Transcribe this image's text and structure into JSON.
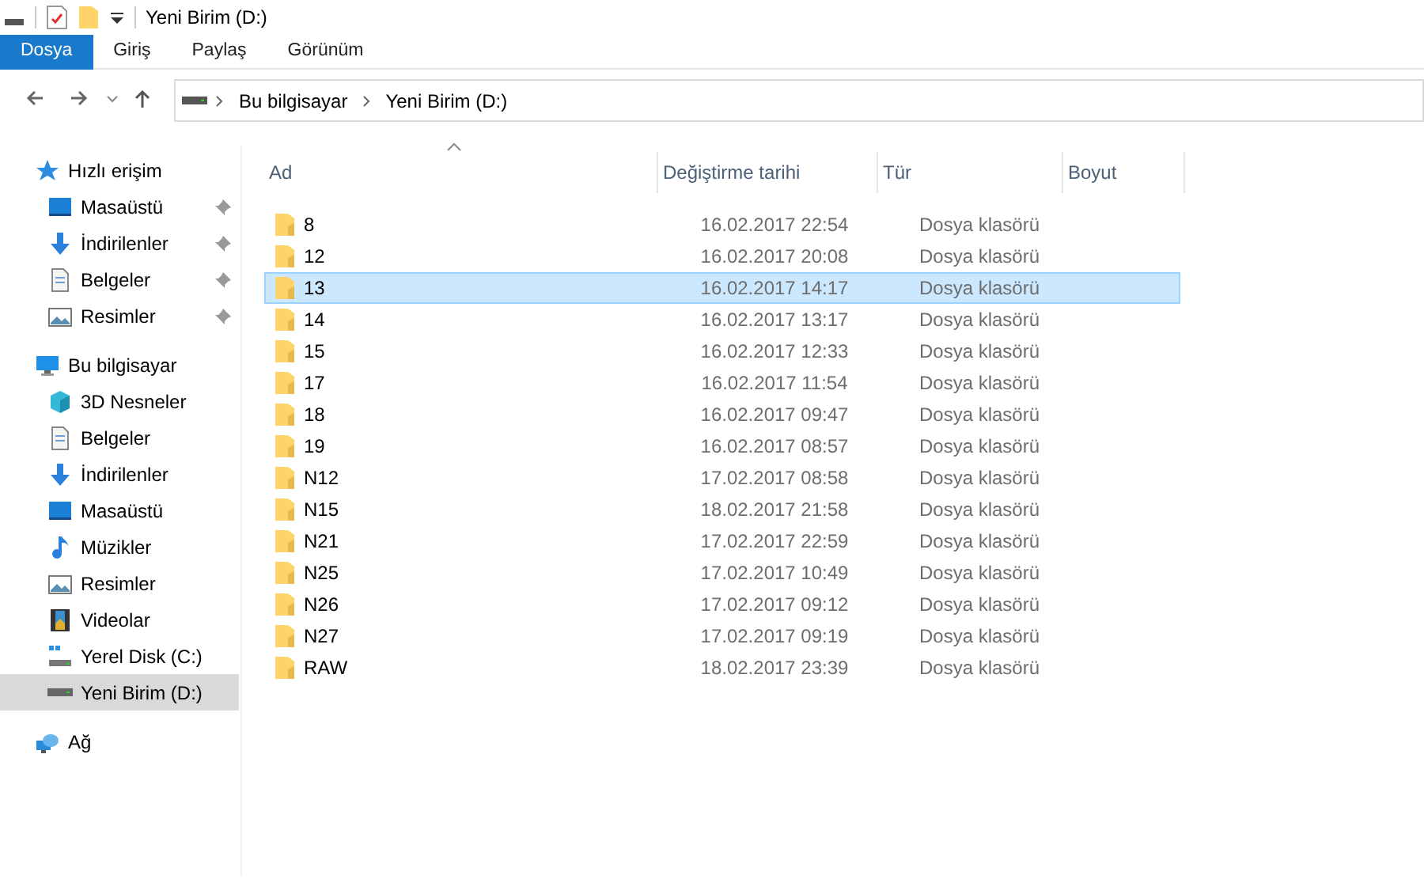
{
  "window": {
    "title": "Yeni Birim (D:)"
  },
  "ribbon_tabs": [
    {
      "label": "Dosya",
      "selected": true
    },
    {
      "label": "Giriş",
      "selected": false
    },
    {
      "label": "Paylaş",
      "selected": false
    },
    {
      "label": "Görünüm",
      "selected": false
    }
  ],
  "breadcrumb": [
    "Bu bilgisayar",
    "Yeni Birim (D:)"
  ],
  "sidebar": {
    "items": [
      {
        "label": "Hızlı erişim",
        "kind": "star",
        "selected": false,
        "children": [
          {
            "label": "Masaüstü",
            "kind": "desktop",
            "pinned": true,
            "selected": false
          },
          {
            "label": "İndirilenler",
            "kind": "download",
            "pinned": true,
            "selected": false
          },
          {
            "label": "Belgeler",
            "kind": "document",
            "pinned": true,
            "selected": false
          },
          {
            "label": "Resimler",
            "kind": "pictures",
            "pinned": true,
            "selected": false
          }
        ]
      },
      {
        "label": "Bu bilgisayar",
        "kind": "computer",
        "selected": false,
        "children": [
          {
            "label": "3D Nesneler",
            "kind": "cube",
            "pinned": false,
            "selected": false
          },
          {
            "label": "Belgeler",
            "kind": "document",
            "pinned": false,
            "selected": false
          },
          {
            "label": "İndirilenler",
            "kind": "download",
            "pinned": false,
            "selected": false
          },
          {
            "label": "Masaüstü",
            "kind": "desktop",
            "pinned": false,
            "selected": false
          },
          {
            "label": "Müzikler",
            "kind": "music",
            "pinned": false,
            "selected": false
          },
          {
            "label": "Resimler",
            "kind": "pictures",
            "pinned": false,
            "selected": false
          },
          {
            "label": "Videolar",
            "kind": "video",
            "pinned": false,
            "selected": false
          },
          {
            "label": "Yerel Disk (C:)",
            "kind": "osdrive",
            "pinned": false,
            "selected": false
          },
          {
            "label": "Yeni Birim (D:)",
            "kind": "drive",
            "pinned": false,
            "selected": true
          }
        ]
      },
      {
        "label": "Ağ",
        "kind": "network",
        "selected": false
      }
    ]
  },
  "table": {
    "columns": [
      {
        "label": "Ad",
        "sorted": true
      },
      {
        "label": "Değiştirme tarihi",
        "sorted": false
      },
      {
        "label": "Tür",
        "sorted": false
      },
      {
        "label": "Boyut",
        "sorted": false
      }
    ],
    "rows": [
      {
        "name": "8",
        "modified": "16.02.2017 22:54",
        "type": "Dosya klasörü",
        "selected": false
      },
      {
        "name": "12",
        "modified": "16.02.2017 20:08",
        "type": "Dosya klasörü",
        "selected": false
      },
      {
        "name": "13",
        "modified": "16.02.2017 14:17",
        "type": "Dosya klasörü",
        "selected": true
      },
      {
        "name": "14",
        "modified": "16.02.2017 13:17",
        "type": "Dosya klasörü",
        "selected": false
      },
      {
        "name": "15",
        "modified": "16.02.2017 12:33",
        "type": "Dosya klasörü",
        "selected": false
      },
      {
        "name": "17",
        "modified": "16.02.2017 11:54",
        "type": "Dosya klasörü",
        "selected": false
      },
      {
        "name": "18",
        "modified": "16.02.2017 09:47",
        "type": "Dosya klasörü",
        "selected": false
      },
      {
        "name": "19",
        "modified": "16.02.2017 08:57",
        "type": "Dosya klasörü",
        "selected": false
      },
      {
        "name": "N12",
        "modified": "17.02.2017 08:58",
        "type": "Dosya klasörü",
        "selected": false
      },
      {
        "name": "N15",
        "modified": "18.02.2017 21:58",
        "type": "Dosya klasörü",
        "selected": false
      },
      {
        "name": "N21",
        "modified": "17.02.2017 22:59",
        "type": "Dosya klasörü",
        "selected": false
      },
      {
        "name": "N25",
        "modified": "17.02.2017 10:49",
        "type": "Dosya klasörü",
        "selected": false
      },
      {
        "name": "N26",
        "modified": "17.02.2017 09:12",
        "type": "Dosya klasörü",
        "selected": false
      },
      {
        "name": "N27",
        "modified": "17.02.2017 09:19",
        "type": "Dosya klasörü",
        "selected": false
      },
      {
        "name": "RAW",
        "modified": "18.02.2017 23:39",
        "type": "Dosya klasörü",
        "selected": false
      }
    ]
  }
}
